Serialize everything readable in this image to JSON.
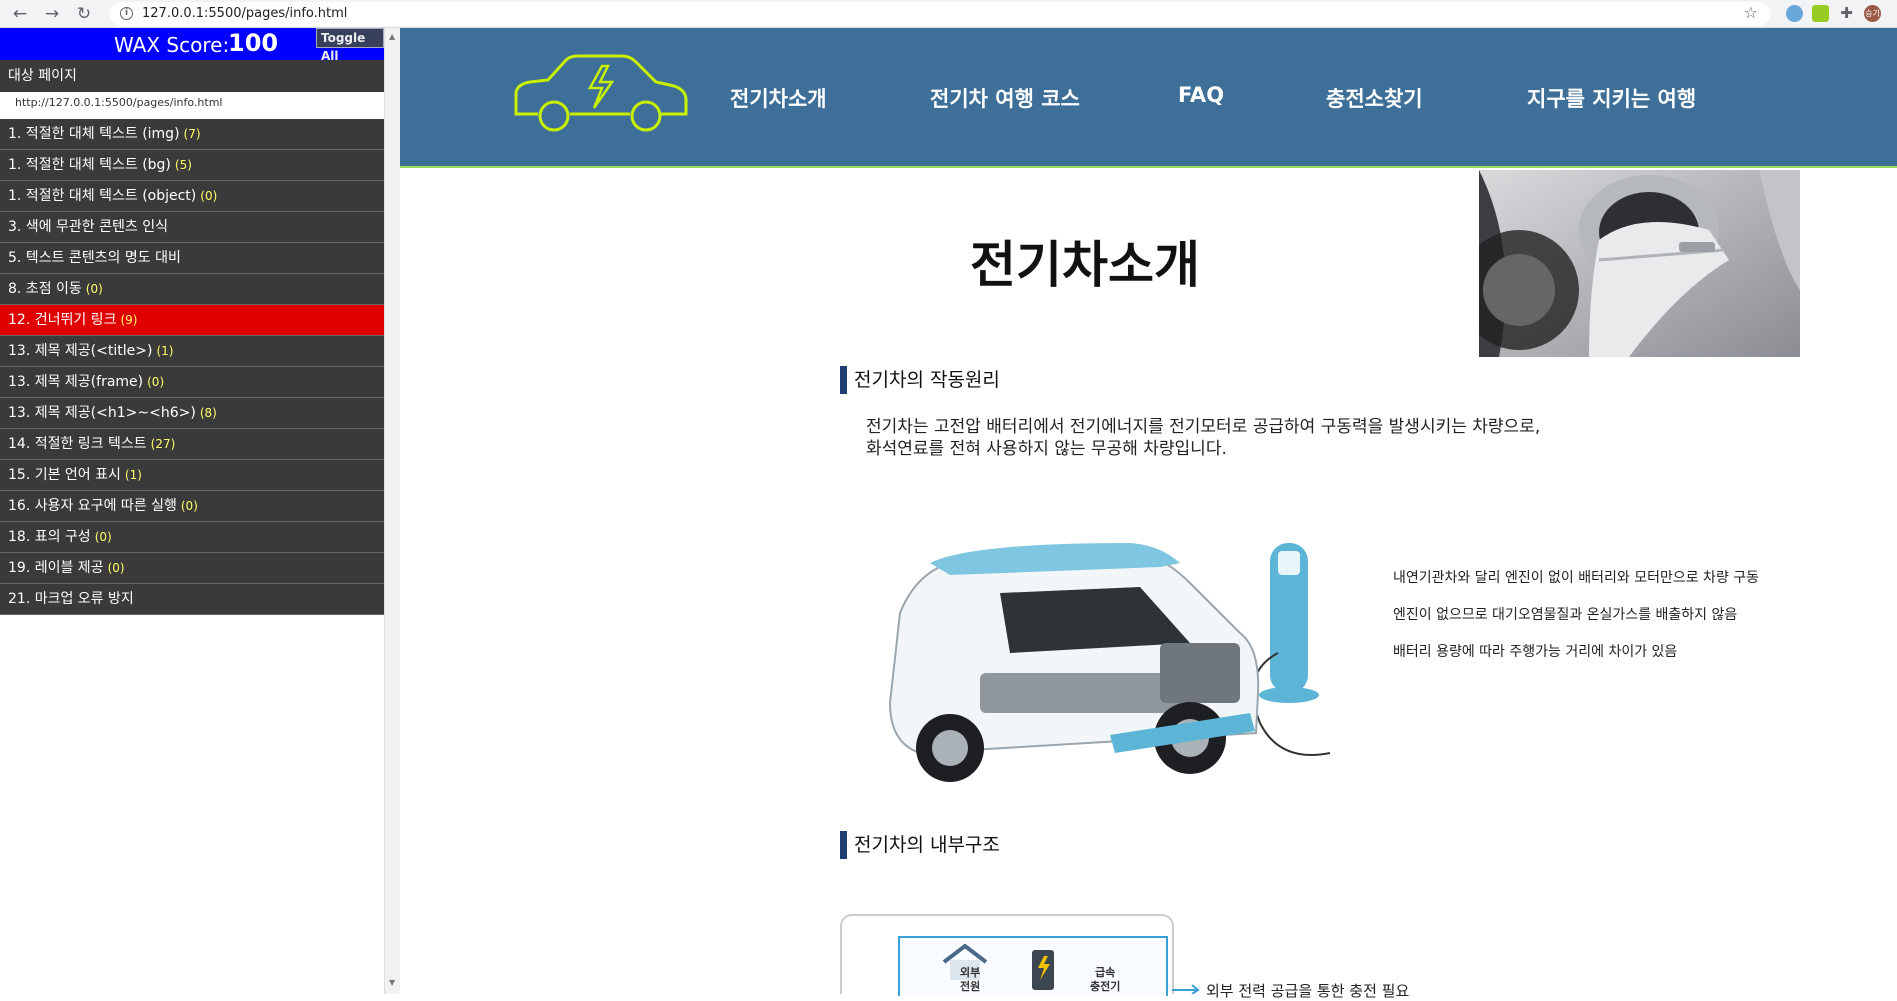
{
  "browser": {
    "back_icon": "←",
    "forward_icon": "→",
    "reload_icon": "↻",
    "info_icon": "i",
    "url": "127.0.0.1:5500/pages/info.html",
    "star_icon": "☆",
    "profile_label": "승기"
  },
  "wax": {
    "score_label": "WAX Score:",
    "score_value": "100",
    "toggle_all": "Toggle All",
    "target_label": "대상 페이지",
    "target_url": "http://127.0.0.1:5500/pages/info.html",
    "items": [
      {
        "label": "1. 적절한 대체 텍스트 (img)",
        "count": "(7)"
      },
      {
        "label": "1. 적절한 대체 텍스트 (bg)",
        "count": "(5)"
      },
      {
        "label": "1. 적절한 대체 텍스트 (object)",
        "count": "(0)"
      },
      {
        "label": "3. 색에 무관한 콘텐츠 인식",
        "count": ""
      },
      {
        "label": "5. 텍스트 콘텐츠의 명도 대비",
        "count": ""
      },
      {
        "label": "8. 초점 이동",
        "count": "(0)"
      },
      {
        "label": "12. 건너뛰기 링크",
        "count": "(9)"
      },
      {
        "label": "13. 제목 제공(<title>)",
        "count": "(1)"
      },
      {
        "label": "13. 제목 제공(frame)",
        "count": "(0)"
      },
      {
        "label": "13. 제목 제공(<h1>~<h6>)",
        "count": "(8)"
      },
      {
        "label": "14. 적절한 링크 텍스트",
        "count": "(27)"
      },
      {
        "label": "15. 기본 언어 표시",
        "count": "(1)"
      },
      {
        "label": "16. 사용자 요구에 따른 실행",
        "count": "(0)"
      },
      {
        "label": "18. 표의 구성",
        "count": "(0)"
      },
      {
        "label": "19. 레이블 제공",
        "count": "(0)"
      },
      {
        "label": "21. 마크업 오류 방지",
        "count": ""
      }
    ]
  },
  "site": {
    "nav": [
      "전기차소개",
      "전기차 여행 코스",
      "FAQ",
      "충전소찾기",
      "지구를 지키는 여행"
    ],
    "page_title": "전기차소개",
    "section1_heading": "전기차의 작동원리",
    "section1_lines": [
      "전기차는 고전압 배터리에서 전기에너지를 전기모터로 공급하여 구동력을 발생시키는 차량으로,",
      "화석연료를 전혀 사용하지 않는 무공해 차량입니다."
    ],
    "features": [
      "내연기관차와 달리 엔진이 없이 배터리와 모터만으로 차량 구동",
      "엔진이 없으므로 대기오염물질과 온실가스를 배출하지 않음",
      "배터리 용량에 따라 주행가능 거리에 차이가 있음"
    ],
    "section2_heading": "전기차의 내부구조",
    "diagram_label_1": "외부\n전원",
    "diagram_label_2": "급속\n충전기",
    "bottom_note": "외부 전력 공급을 통한 충전 필요"
  },
  "colors": {
    "wax_header": "#0000ff",
    "wax_item_bg": "#3a3a3a",
    "wax_item_active": "#e00000",
    "site_header": "#3d6f99",
    "logo_accent": "#c8f000",
    "heading_bar": "#1d3f74"
  }
}
